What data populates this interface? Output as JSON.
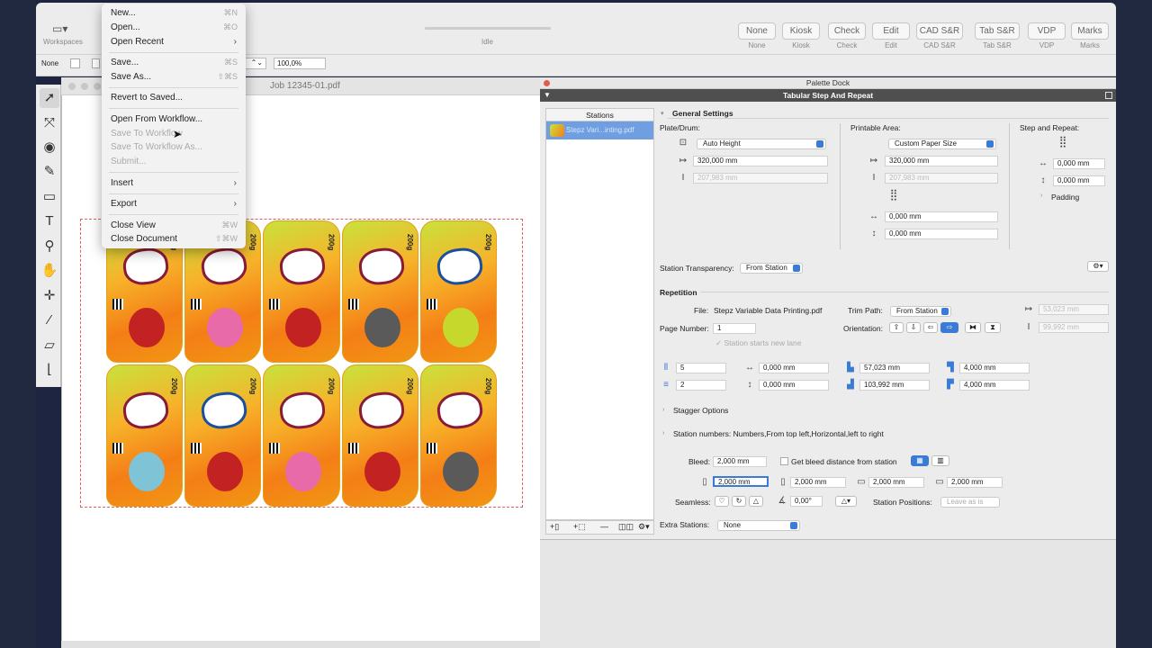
{
  "toolbar": {
    "workspaces": "Workspaces",
    "status": "Idle",
    "buttons": [
      {
        "label": "None",
        "sub": "None"
      },
      {
        "label": "Kiosk",
        "sub": "Kiosk"
      },
      {
        "label": "Check",
        "sub": "Check"
      },
      {
        "label": "Edit",
        "sub": "Edit"
      },
      {
        "label": "CAD S&R",
        "sub": "CAD S&R"
      },
      {
        "label": "Tab S&R",
        "sub": "Tab S&R"
      },
      {
        "label": "VDP",
        "sub": "VDP"
      },
      {
        "label": "Marks",
        "sub": "Marks"
      }
    ]
  },
  "infobar": {
    "none_label": "None",
    "zoom": "100,0%"
  },
  "document": {
    "title": "Job 12345-01.pdf",
    "label_weight": "200g"
  },
  "menu": {
    "items": [
      {
        "label": "New...",
        "shortcut": "⌘N"
      },
      {
        "label": "Open...",
        "shortcut": "⌘O"
      },
      {
        "label": "Open Recent"
      },
      {
        "label": "Save...",
        "shortcut": "⌘S"
      },
      {
        "label": "Save As...",
        "shortcut": "⇧⌘S"
      },
      {
        "label": "Revert to Saved..."
      },
      {
        "label": "Open From Workflow..."
      },
      {
        "label": "Save To Workflow"
      },
      {
        "label": "Save To Workflow As..."
      },
      {
        "label": "Submit..."
      },
      {
        "label": "Insert"
      },
      {
        "label": "Export"
      },
      {
        "label": "Close View",
        "shortcut": "⌘W"
      },
      {
        "label": "Close Document",
        "shortcut": "⇧⌘W"
      }
    ]
  },
  "dock": {
    "title": "Palette Dock",
    "panel_title": "Tabular Step And Repeat"
  },
  "stations": {
    "header": "Stations",
    "item": "Stepz Vari...inting.pdf"
  },
  "general": {
    "title": "General Settings",
    "plate": "Plate/Drum:",
    "plate_mode": "Auto Height",
    "plate_w": "320,000 mm",
    "plate_h": "207,983 mm",
    "printable": "Printable Area:",
    "printable_mode": "Custom Paper Size",
    "print_w": "320,000 mm",
    "print_h": "207,983 mm",
    "print_x": "0,000 mm",
    "print_y": "0,000 mm",
    "snr": "Step and Repeat:",
    "snr_x": "0,000 mm",
    "snr_y": "0,000 mm",
    "padding": "Padding",
    "transparency_label": "Station Transparency:",
    "transparency": "From Station"
  },
  "repetition": {
    "title": "Repetition",
    "file_label": "File:",
    "file": "Stepz Variable Data Printing.pdf",
    "trim_label": "Trim Path:",
    "trim": "From Station",
    "trim_w": "53,023 mm",
    "trim_h": "99,992 mm",
    "page_label": "Page Number:",
    "page": "1",
    "orientation_label": "Orientation:",
    "new_lane": "Station starts new lane",
    "cols": "5",
    "rows": "2",
    "gap_h": "0,000 mm",
    "gap_v": "0,000 mm",
    "step_h": "57,023 mm",
    "step_v": "103,992 mm",
    "m1": "4,000 mm",
    "m2": "4,000 mm",
    "stagger": "Stagger Options",
    "numbers": "Station numbers: Numbers,From top left,Horizontal,left to right",
    "bleed_label": "Bleed:",
    "bleed": "2,000 mm",
    "bleed_check": "Get bleed distance from station",
    "b_left": "2,000 mm",
    "b_top": "2,000 mm",
    "b_right": "2,000 mm",
    "b_bottom": "2,000 mm",
    "seamless": "Seamless:",
    "angle": "0,00°",
    "positions_label": "Station Positions:",
    "positions": "Leave as is",
    "extra_label": "Extra Stations:",
    "extra": "None"
  }
}
